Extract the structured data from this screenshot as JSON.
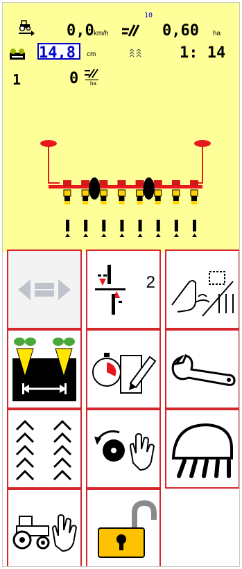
{
  "status": {
    "speed": "0,0",
    "speed_unit": "km/h",
    "satellites": "10",
    "area": "0,60",
    "area_unit": "ha",
    "row_spacing": "14,8",
    "row_spacing_unit": "cm",
    "ratio": "1: 14",
    "row_number": "1",
    "density": "0",
    "colors": {
      "background": "#ffff99",
      "input_border": "#0000cc",
      "satellite_text": "#0000cc"
    },
    "icons": [
      "tractor-speed-icon",
      "gps-signal-icon",
      "seed-spacing-icon",
      "row-pattern-icon",
      "seed-density-icon"
    ]
  },
  "machine_view": {
    "row_units": 8,
    "wheels": 2,
    "colors": {
      "frame": "#e8181e",
      "unit": "#d21818",
      "hopper": "#ffd200",
      "wheel": "#000000"
    }
  },
  "menu": {
    "tiles": [
      {
        "name": "lateral-shift-tile",
        "icon": "lateral-shift-icon",
        "enabled": false
      },
      {
        "name": "section-control-tile",
        "icon": "section-control-icon",
        "badge": "2",
        "enabled": true
      },
      {
        "name": "touch-settings-tile",
        "icon": "touch-settings-icon",
        "enabled": true
      },
      {
        "name": "row-spacing-setup-tile",
        "icon": "beet-row-spacing-icon",
        "enabled": true
      },
      {
        "name": "calibration-tile",
        "icon": "stopwatch-edit-icon",
        "enabled": true
      },
      {
        "name": "service-tile",
        "icon": "wrench-icon",
        "enabled": true
      },
      {
        "name": "tramline-tile",
        "icon": "tramline-chevrons-icon",
        "enabled": true
      },
      {
        "name": "seed-disc-tile",
        "icon": "seed-disc-hand-icon",
        "enabled": true
      },
      {
        "name": "work-lights-tile",
        "icon": "work-lights-icon",
        "enabled": true
      },
      {
        "name": "tractor-manual-tile",
        "icon": "tractor-hand-icon",
        "enabled": true
      },
      {
        "name": "unlock-tile",
        "icon": "open-padlock-icon",
        "enabled": true
      }
    ],
    "colors": {
      "border": "#d6262b",
      "padlock": "#ffc200"
    }
  }
}
